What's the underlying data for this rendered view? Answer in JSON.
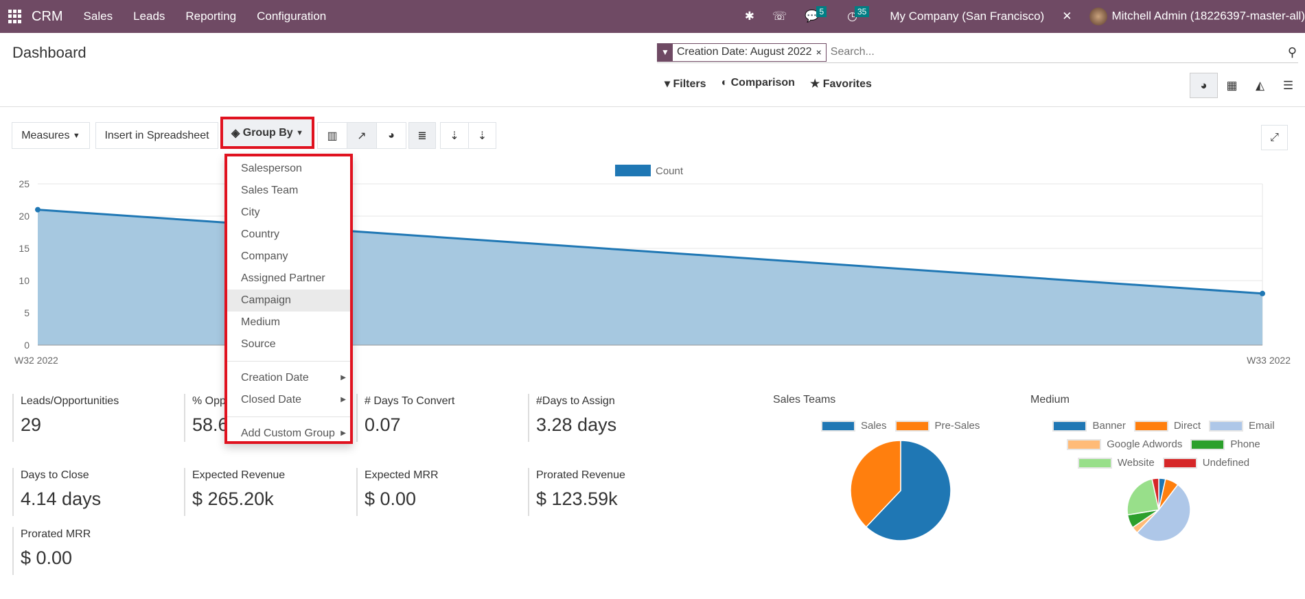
{
  "navbar": {
    "app": "CRM",
    "menus": [
      "Sales",
      "Leads",
      "Reporting",
      "Configuration"
    ],
    "messages_count": "5",
    "activities_count": "35",
    "company": "My Company (San Francisco)",
    "user": "Mitchell Admin (18226397-master-all)"
  },
  "page": {
    "title": "Dashboard"
  },
  "search": {
    "facet": "Creation Date: August 2022",
    "placeholder": "Search..."
  },
  "filters": {
    "filters": "Filters",
    "comparison": "Comparison",
    "favorites": "Favorites"
  },
  "toolbar": {
    "measures": "Measures",
    "insert": "Insert in Spreadsheet",
    "group_by": "Group By"
  },
  "group_by_menu": {
    "items": [
      "Salesperson",
      "Sales Team",
      "City",
      "Country",
      "Company",
      "Assigned Partner",
      "Campaign",
      "Medium",
      "Source"
    ],
    "date_items": [
      "Creation Date",
      "Closed Date"
    ],
    "custom": "Add Custom Group",
    "highlighted": "Campaign"
  },
  "chart_data": [
    {
      "type": "area",
      "legend": [
        "Count"
      ],
      "x": [
        "W32 2022",
        "W33 2022"
      ],
      "series": [
        {
          "name": "Count",
          "values": [
            21,
            8
          ]
        }
      ],
      "yticks": [
        0,
        5,
        10,
        15,
        20,
        25
      ],
      "ylim": [
        0,
        25
      ],
      "grid": true,
      "legend_placement": "top",
      "color": "#1f77b4"
    },
    {
      "type": "pie",
      "title": "Sales Teams",
      "categories": [
        "Sales",
        "Pre-Sales"
      ],
      "values": [
        18,
        11
      ],
      "colors": [
        "#1f77b4",
        "#ff7f0e"
      ]
    },
    {
      "type": "pie",
      "title": "Medium",
      "categories": [
        "Banner",
        "Direct",
        "Email",
        "Google Adwords",
        "Phone",
        "Website",
        "Undefined"
      ],
      "values": [
        1,
        2,
        15,
        1,
        2,
        7,
        1
      ],
      "colors": [
        "#1f77b4",
        "#ff7f0e",
        "#aec7e8",
        "#ffbb78",
        "#2ca02c",
        "#98df8a",
        "#d62728"
      ]
    }
  ],
  "kpis": [
    {
      "label": "Leads/Opportunities",
      "value": "29"
    },
    {
      "label": "% Opp",
      "value": "58.6"
    },
    {
      "label": "# Days To Convert",
      "value": "0.07"
    },
    {
      "label": "#Days to Assign",
      "value": "3.28 days"
    },
    {
      "label": "Days to Close",
      "value": "4.14 days"
    },
    {
      "label": "Expected Revenue",
      "value": "$ 265.20k"
    },
    {
      "label": "Expected MRR",
      "value": "$ 0.00"
    },
    {
      "label": "Prorated Revenue",
      "value": "$ 123.59k"
    },
    {
      "label": "Prorated MRR",
      "value": "$ 0.00"
    }
  ]
}
